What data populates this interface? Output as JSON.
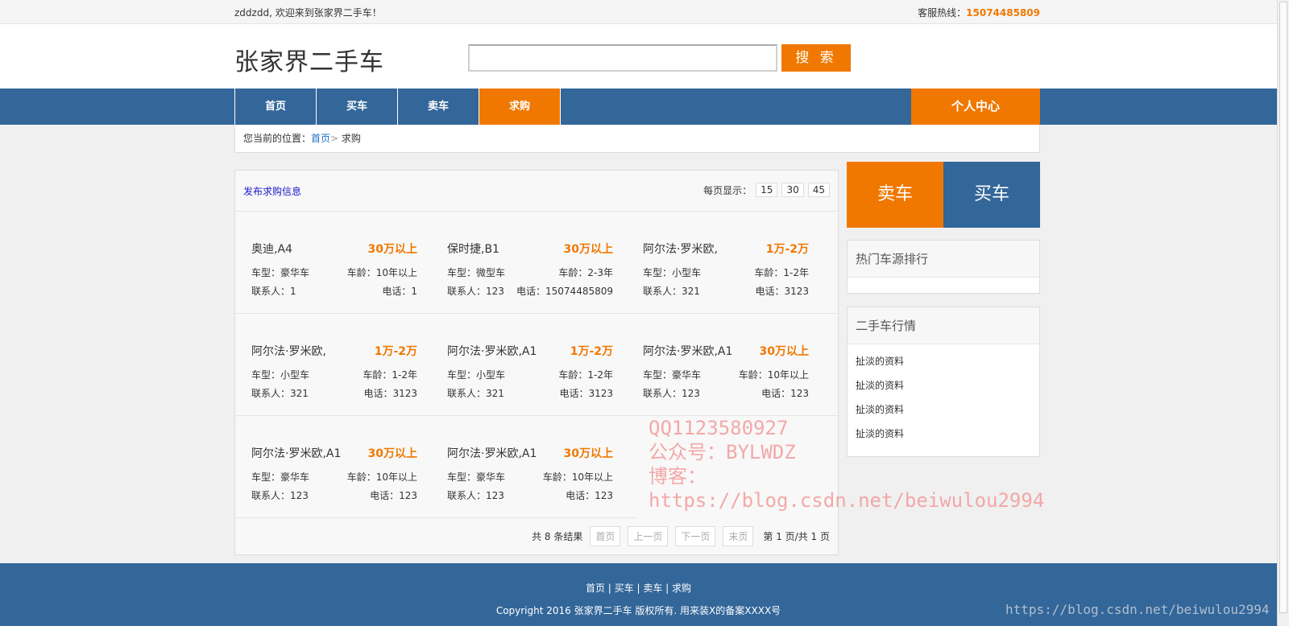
{
  "topbar": {
    "welcome": "zddzdd, 欢迎来到张家界二手车！",
    "hotline_label": "客服热线：",
    "hotline_number": "15074485809"
  },
  "header": {
    "logo": "张家界二手车",
    "search_placeholder": "",
    "search_button": "搜 索"
  },
  "nav": {
    "items": [
      {
        "label": "首页"
      },
      {
        "label": "买车"
      },
      {
        "label": "卖车"
      },
      {
        "label": "求购"
      }
    ],
    "personal": "个人中心"
  },
  "breadcrumb": {
    "prefix": "您当前的位置：",
    "home": "首页",
    "separator": ">",
    "current": "求购"
  },
  "toolbar": {
    "publish": "发布求购信息",
    "perpage_label": "每页显示：",
    "perpage_options": [
      "15",
      "30",
      "45"
    ]
  },
  "labels": {
    "type": "车型：",
    "age": "车龄：",
    "contact": "联系人：",
    "phone": "电话："
  },
  "listings": [
    {
      "name": "奥迪,A4",
      "price": "30万以上",
      "type": "豪华车",
      "age": "10年以上",
      "contact": "1",
      "phone": "1"
    },
    {
      "name": "保时捷,B1",
      "price": "30万以上",
      "type": "微型车",
      "age": "2-3年",
      "contact": "123",
      "phone": "15074485809"
    },
    {
      "name": "阿尔法·罗米欧,",
      "price": "1万-2万",
      "type": "小型车",
      "age": "1-2年",
      "contact": "321",
      "phone": "3123"
    },
    {
      "name": "阿尔法·罗米欧,",
      "price": "1万-2万",
      "type": "小型车",
      "age": "1-2年",
      "contact": "321",
      "phone": "3123"
    },
    {
      "name": "阿尔法·罗米欧,A1",
      "price": "1万-2万",
      "type": "小型车",
      "age": "1-2年",
      "contact": "321",
      "phone": "3123"
    },
    {
      "name": "阿尔法·罗米欧,A1",
      "price": "30万以上",
      "type": "豪华车",
      "age": "10年以上",
      "contact": "123",
      "phone": "123"
    },
    {
      "name": "阿尔法·罗米欧,A1",
      "price": "30万以上",
      "type": "豪华车",
      "age": "10年以上",
      "contact": "123",
      "phone": "123"
    },
    {
      "name": "阿尔法·罗米欧,A1",
      "price": "30万以上",
      "type": "豪华车",
      "age": "10年以上",
      "contact": "123",
      "phone": "123"
    }
  ],
  "pager": {
    "total": "共 8 条结果",
    "first": "首页",
    "prev": "上一页",
    "next": "下一页",
    "last": "末页",
    "info": "第 1 页/共 1 页"
  },
  "sidebar": {
    "sell": "卖车",
    "buy": "买车",
    "hot_title": "热门车源排行",
    "market_title": "二手车行情",
    "market_items": [
      "扯淡的资料",
      "扯淡的资料",
      "扯淡的资料",
      "扯淡的资料"
    ]
  },
  "footer": {
    "links": [
      "首页",
      "买车",
      "卖车",
      "求购"
    ],
    "link_sep": " | ",
    "copyright": "Copyright 2016 张家界二手车 版权所有. 用来装X的备案XXXX号"
  },
  "watermark": {
    "lines": [
      "QQ1123580927",
      "公众号：BYLWDZ",
      "博客：",
      "https://blog.csdn.net/beiwulou2994"
    ],
    "corner": "https://blog.csdn.net/beiwulou2994"
  },
  "colors": {
    "accent": "#f07800",
    "primary": "#336699",
    "link": "#1e6fc9"
  }
}
